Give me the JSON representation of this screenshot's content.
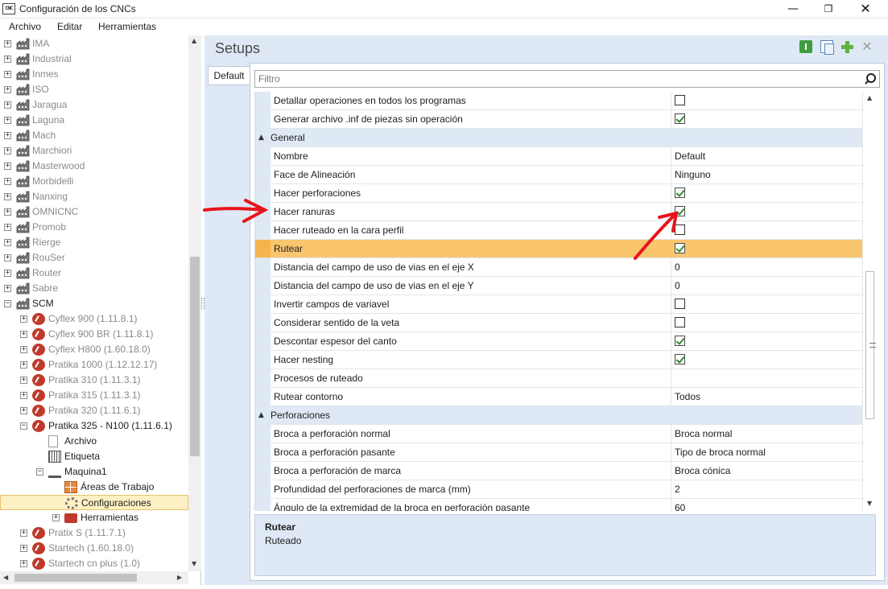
{
  "window": {
    "icon_text": "CNC",
    "title": "Configuración de los CNCs",
    "minimize": "—",
    "maximize": "❐",
    "close": "✕"
  },
  "menu": [
    "Archivo",
    "Editar",
    "Herramientas"
  ],
  "tree": [
    {
      "label": "IMA",
      "icon": "factory-icon",
      "level": 0,
      "exp": "+"
    },
    {
      "label": "Industrial",
      "icon": "factory-icon",
      "level": 0,
      "exp": "+"
    },
    {
      "label": "Inmes",
      "icon": "factory-icon",
      "level": 0,
      "exp": "+"
    },
    {
      "label": "ISO",
      "icon": "factory-icon",
      "level": 0,
      "exp": "+"
    },
    {
      "label": "Jaragua",
      "icon": "factory-icon",
      "level": 0,
      "exp": "+"
    },
    {
      "label": "Laguna",
      "icon": "factory-icon",
      "level": 0,
      "exp": "+"
    },
    {
      "label": "Mach",
      "icon": "factory-icon",
      "level": 0,
      "exp": "+"
    },
    {
      "label": "Marchiori",
      "icon": "factory-icon",
      "level": 0,
      "exp": "+"
    },
    {
      "label": "Masterwood",
      "icon": "factory-icon",
      "level": 0,
      "exp": "+"
    },
    {
      "label": "Morbidelli",
      "icon": "factory-icon",
      "level": 0,
      "exp": "+"
    },
    {
      "label": "Nanxing",
      "icon": "factory-icon",
      "level": 0,
      "exp": "+"
    },
    {
      "label": "OMNICNC",
      "icon": "factory-icon",
      "level": 0,
      "exp": "+"
    },
    {
      "label": "Promob",
      "icon": "factory-icon",
      "level": 0,
      "exp": "+"
    },
    {
      "label": "Rierge",
      "icon": "factory-icon",
      "level": 0,
      "exp": "+"
    },
    {
      "label": "RouSer",
      "icon": "factory-icon",
      "level": 0,
      "exp": "+"
    },
    {
      "label": "Router",
      "icon": "factory-icon",
      "level": 0,
      "exp": "+"
    },
    {
      "label": "Sabre",
      "icon": "factory-icon",
      "level": 0,
      "exp": "+"
    },
    {
      "label": "SCM",
      "icon": "factory-icon",
      "level": 0,
      "exp": "−",
      "dark": true
    },
    {
      "label": "Cyflex 900 (1.11.8.1)",
      "icon": "scm-machine-icon",
      "level": 1,
      "exp": "+"
    },
    {
      "label": "Cyflex 900 BR (1.11.8.1)",
      "icon": "scm-machine-icon",
      "level": 1,
      "exp": "+"
    },
    {
      "label": "Cyflex H800 (1.60.18.0)",
      "icon": "scm-machine-icon",
      "level": 1,
      "exp": "+"
    },
    {
      "label": "Pratika 1000 (1.12.12.17)",
      "icon": "scm-machine-icon",
      "level": 1,
      "exp": "+"
    },
    {
      "label": "Pratika 310 (1.11.3.1)",
      "icon": "scm-machine-icon",
      "level": 1,
      "exp": "+"
    },
    {
      "label": "Pratika 315 (1.11.3.1)",
      "icon": "scm-machine-icon",
      "level": 1,
      "exp": "+"
    },
    {
      "label": "Pratika 320 (1.11.6.1)",
      "icon": "scm-machine-icon",
      "level": 1,
      "exp": "+"
    },
    {
      "label": "Pratika 325 - N100 (1.11.6.1)",
      "icon": "scm-machine-icon",
      "level": 1,
      "exp": "−",
      "dark": true
    },
    {
      "label": "Archivo",
      "icon": "document-icon",
      "level": 2,
      "exp": "",
      "dark": true
    },
    {
      "label": "Etiqueta",
      "icon": "label-icon",
      "level": 2,
      "exp": "",
      "dark": true
    },
    {
      "label": "Maquina1",
      "icon": "machine-icon",
      "level": 2,
      "exp": "−",
      "dark": true
    },
    {
      "label": "Áreas de Trabajo",
      "icon": "work-areas-icon",
      "level": 3,
      "exp": "",
      "dark": true
    },
    {
      "label": "Configuraciones",
      "icon": "gear-icon",
      "level": 3,
      "exp": "",
      "dark": true,
      "selected": true
    },
    {
      "label": "Herramientas",
      "icon": "toolbox-icon",
      "level": 3,
      "exp": "+",
      "dark": true
    },
    {
      "label": "Pratix S (1.11.7.1)",
      "icon": "scm-machine-icon",
      "level": 1,
      "exp": "+"
    },
    {
      "label": "Startech (1.60.18.0)",
      "icon": "scm-machine-icon",
      "level": 1,
      "exp": "+"
    },
    {
      "label": "Startech cn plus (1.0)",
      "icon": "scm-machine-icon",
      "level": 1,
      "exp": "+"
    }
  ],
  "setups": {
    "title": "Setups",
    "tab": "Default",
    "filter_placeholder": "Filtro",
    "delete_glyph": "✕"
  },
  "grid": [
    {
      "type": "prop",
      "name": "Detallar operaciones en todos los programas",
      "kind": "check",
      "value": false
    },
    {
      "type": "prop",
      "name": "Generar archivo .inf de piezas sin operación",
      "kind": "check",
      "value": true
    },
    {
      "type": "cat",
      "name": "General",
      "caret": "▲"
    },
    {
      "type": "prop",
      "name": "Nombre",
      "kind": "text",
      "value": "Default"
    },
    {
      "type": "prop",
      "name": "Face de Alineación",
      "kind": "text",
      "value": "Ninguno"
    },
    {
      "type": "prop",
      "name": "Hacer perforaciones",
      "kind": "check",
      "value": true
    },
    {
      "type": "prop",
      "name": "Hacer ranuras",
      "kind": "check",
      "value": true
    },
    {
      "type": "prop",
      "name": "Hacer ruteado en la cara perfil",
      "kind": "check",
      "value": false
    },
    {
      "type": "prop",
      "name": "Rutear",
      "kind": "check",
      "value": true,
      "selected": true
    },
    {
      "type": "prop",
      "name": "Distancia del campo de uso de vias en el eje X",
      "kind": "text",
      "value": "0"
    },
    {
      "type": "prop",
      "name": "Distancia del campo de uso de vias en el eje Y",
      "kind": "text",
      "value": "0"
    },
    {
      "type": "prop",
      "name": "Invertir campos de variavel",
      "kind": "check",
      "value": false
    },
    {
      "type": "prop",
      "name": "Considerar sentido de la veta",
      "kind": "check",
      "value": false
    },
    {
      "type": "prop",
      "name": "Descontar espesor del canto",
      "kind": "check",
      "value": true
    },
    {
      "type": "prop",
      "name": "Hacer nesting",
      "kind": "check",
      "value": true
    },
    {
      "type": "prop",
      "name": "Procesos de ruteado",
      "kind": "text",
      "value": ""
    },
    {
      "type": "prop",
      "name": "Rutear contorno",
      "kind": "text",
      "value": "Todos"
    },
    {
      "type": "cat",
      "name": "Perforaciones",
      "caret": "▲"
    },
    {
      "type": "prop",
      "name": "Broca a perforación normal",
      "kind": "text",
      "value": "Broca normal"
    },
    {
      "type": "prop",
      "name": "Broca a perforación pasante",
      "kind": "text",
      "value": "Tipo de broca normal"
    },
    {
      "type": "prop",
      "name": "Broca a perforación de marca",
      "kind": "text",
      "value": "Broca cónica"
    },
    {
      "type": "prop",
      "name": "Profundidad del perforaciones de marca (mm)",
      "kind": "text",
      "value": "2"
    },
    {
      "type": "prop",
      "name": "Ángulo de la extremidad de la broca en perforación pasante",
      "kind": "text",
      "value": "60"
    }
  ],
  "description": {
    "title": "Rutear",
    "text": "Ruteado"
  },
  "colors": {
    "selected_row": "#f9c66e",
    "category_bg": "#dfe9f5",
    "annotation_arrow": "#e8141c"
  }
}
